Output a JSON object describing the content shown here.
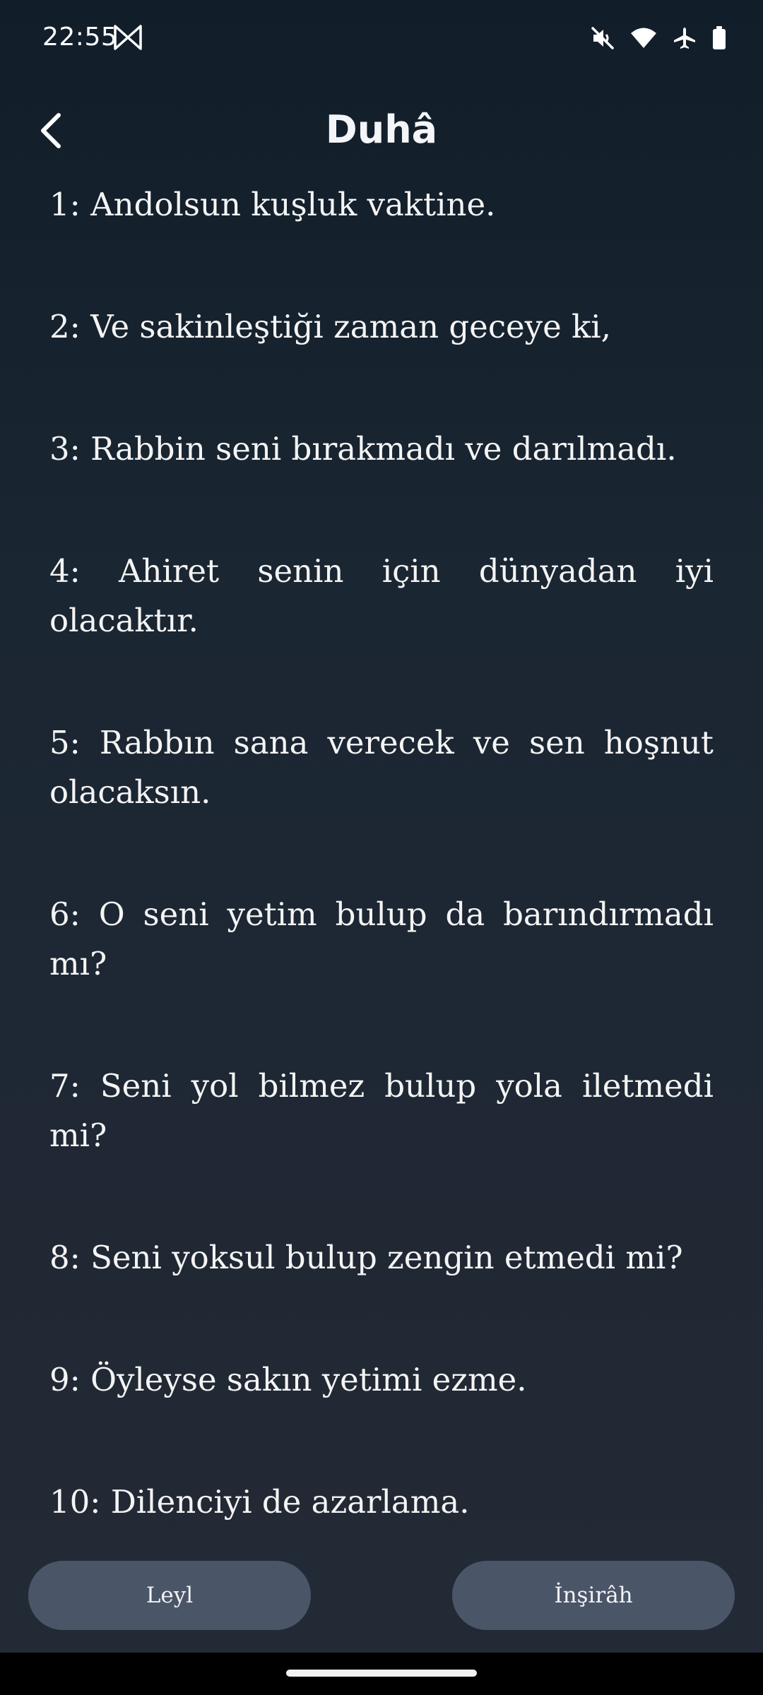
{
  "status_bar": {
    "time": "22:55",
    "icons": [
      "notification-icon",
      "mute-icon",
      "wifi-icon",
      "airplane-icon",
      "battery-icon"
    ]
  },
  "header": {
    "title": "Duhâ",
    "back_icon": "chevron-left-icon"
  },
  "verses": [
    "1: Andolsun kuşluk vaktine.",
    "2: Ve sakinleştiği zaman geceye ki,",
    "3: Rabbin seni bırakmadı ve darılmadı.",
    "4: Ahiret senin için dünyadan iyi olacaktır.",
    "5: Rabbın sana verecek ve sen hoşnut olacaksın.",
    "6: O seni yetim bulup da barındırmadı mı?",
    "7: Seni yol bilmez bulup yola iletmedi mi?",
    "8: Seni yoksul bulup zengin etmedi mi?",
    "9: Öyleyse sakın yetimi ezme.",
    "10: Dilenciyi de azarlama."
  ],
  "navigation": {
    "previous_label": "Leyl",
    "next_label": "İnşirâh"
  },
  "colors": {
    "background_top": "#111d29",
    "background_bottom": "#232a35",
    "button_bg": "#4b5568",
    "text": "#f4f4f4"
  }
}
